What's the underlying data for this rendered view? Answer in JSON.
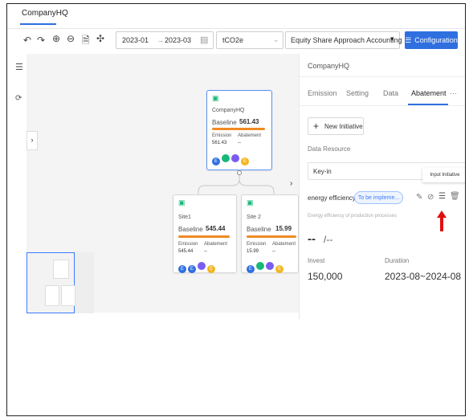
{
  "header": {
    "tab": "CompanyHQ"
  },
  "toolbar": {
    "start_period": "2023-01",
    "arrow": "→",
    "end_period": "2023-03",
    "unit": "tCO2e",
    "approach": "Equity Share Approach Accounting",
    "config_label": "Configuration"
  },
  "canvas": {
    "root": {
      "name": "CompanyHQ",
      "baseline_label": "Baseline",
      "baseline_value": "561.43",
      "emission_label": "Emission",
      "abatement_label": "Abatement",
      "emission_value": "561.43",
      "abatement_value": "--"
    },
    "site1": {
      "name": "Site1",
      "baseline_label": "Baseline",
      "baseline_value": "545.44",
      "emission_label": "Emission",
      "abatement_label": "Abatement",
      "emission_value": "545.44",
      "abatement_value": "--"
    },
    "site2": {
      "name": "Site 2",
      "baseline_label": "Baseline",
      "baseline_value": "15.99",
      "emission_label": "Emission",
      "abatement_label": "Abatement",
      "emission_value": "15.99",
      "abatement_value": "--"
    },
    "colors": {
      "blue": "#2f6fe0",
      "green": "#19b87a",
      "purple": "#7b5cf0",
      "yellow": "#f2b61f",
      "orange": "#f08a24"
    }
  },
  "panel": {
    "title": "CompanyHQ",
    "tabs": [
      "Emission",
      "Setting",
      "Data",
      "Abatement",
      "···"
    ],
    "new_initiative": "New Initiative",
    "data_resource_label": "Data Resource",
    "data_resource_value": "Key-in",
    "tooltip": "Input Initiative",
    "initiative_title": "energy efficiency",
    "status": "To be impleme...",
    "subtitle": "Energy efficiency of production processes",
    "value_big": "--",
    "value_unit": "/--",
    "invest_label": "Invest",
    "invest_value": "150,000",
    "duration_label": "Duration",
    "duration_value": "2023-08~2024-08"
  }
}
